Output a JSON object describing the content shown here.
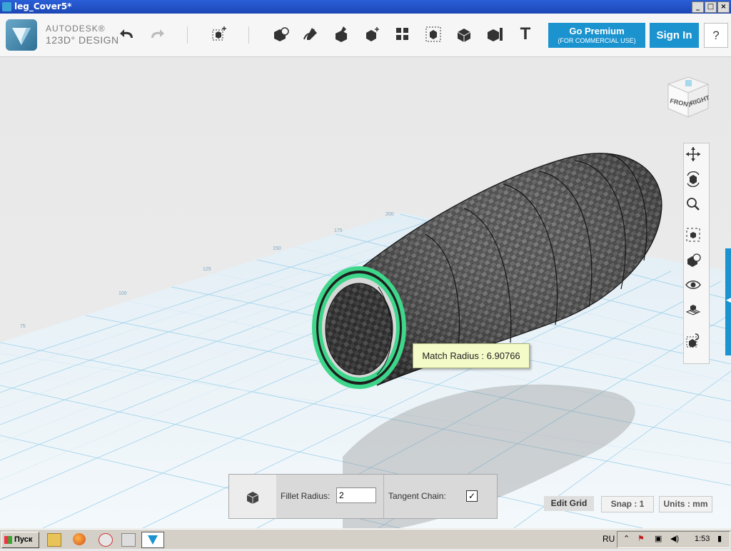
{
  "window": {
    "title": "leg_Cover5*",
    "min": "_",
    "max": "□",
    "close": "×"
  },
  "toolbar": {
    "brand_top": "AUTODESK®",
    "brand_bottom": "123D° DESIGN",
    "premium_label": "Go Premium",
    "premium_sub": "(FOR COMMERCIAL USE)",
    "signin_label": "Sign In",
    "help_label": "?",
    "text_tool": "T"
  },
  "viewport": {
    "tooltip": "Match Radius : 6.90766",
    "grid_labels": [
      "75",
      "100",
      "125",
      "150",
      "175",
      "200"
    ],
    "viewcube": {
      "front": "FRONT",
      "right": "RIGHT"
    }
  },
  "fillet_panel": {
    "fillet_label": "Fillet Radius:",
    "fillet_value": "2",
    "tangent_label": "Tangent Chain:",
    "tangent_checked": true,
    "check_glyph": "✓"
  },
  "grid_controls": {
    "edit_grid": "Edit Grid",
    "snap": "Snap : 1",
    "units": "Units : mm"
  },
  "taskbar": {
    "start_label": "Пуск",
    "language": "RU",
    "time": "1:53"
  },
  "colors": {
    "accent": "#1b93cf",
    "highlight": "#3dd68a",
    "tooltip_bg": "#f5fbc8"
  }
}
